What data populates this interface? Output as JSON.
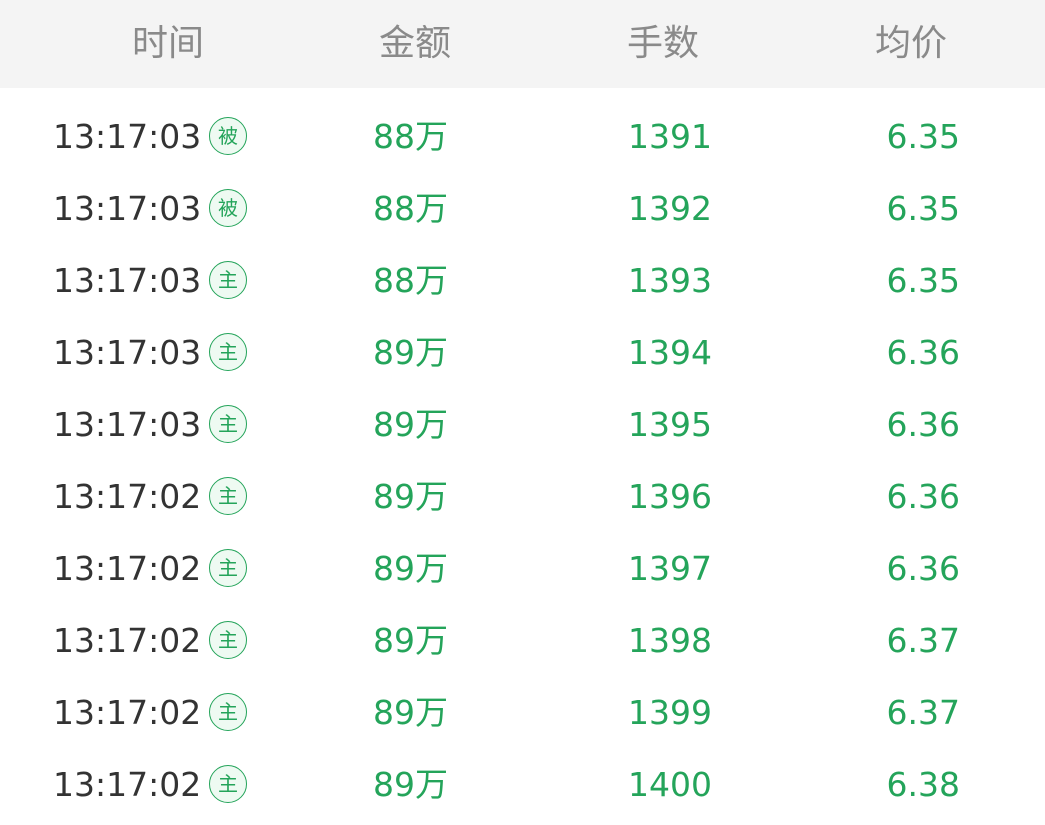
{
  "header": {
    "time": "时间",
    "amount": "金额",
    "lots": "手数",
    "avg_price": "均价"
  },
  "colors": {
    "green": "#24a45a",
    "header_bg": "#f4f4f4",
    "header_text": "#8a8a8a",
    "time_text": "#333333"
  },
  "rows": [
    {
      "time": "13:17:03",
      "badge": "被",
      "amount": "88万",
      "lots": "1391",
      "avg": "6.35"
    },
    {
      "time": "13:17:03",
      "badge": "被",
      "amount": "88万",
      "lots": "1392",
      "avg": "6.35"
    },
    {
      "time": "13:17:03",
      "badge": "主",
      "amount": "88万",
      "lots": "1393",
      "avg": "6.35"
    },
    {
      "time": "13:17:03",
      "badge": "主",
      "amount": "89万",
      "lots": "1394",
      "avg": "6.36"
    },
    {
      "time": "13:17:03",
      "badge": "主",
      "amount": "89万",
      "lots": "1395",
      "avg": "6.36"
    },
    {
      "time": "13:17:02",
      "badge": "主",
      "amount": "89万",
      "lots": "1396",
      "avg": "6.36"
    },
    {
      "time": "13:17:02",
      "badge": "主",
      "amount": "89万",
      "lots": "1397",
      "avg": "6.36"
    },
    {
      "time": "13:17:02",
      "badge": "主",
      "amount": "89万",
      "lots": "1398",
      "avg": "6.37"
    },
    {
      "time": "13:17:02",
      "badge": "主",
      "amount": "89万",
      "lots": "1399",
      "avg": "6.37"
    },
    {
      "time": "13:17:02",
      "badge": "主",
      "amount": "89万",
      "lots": "1400",
      "avg": "6.38"
    }
  ]
}
